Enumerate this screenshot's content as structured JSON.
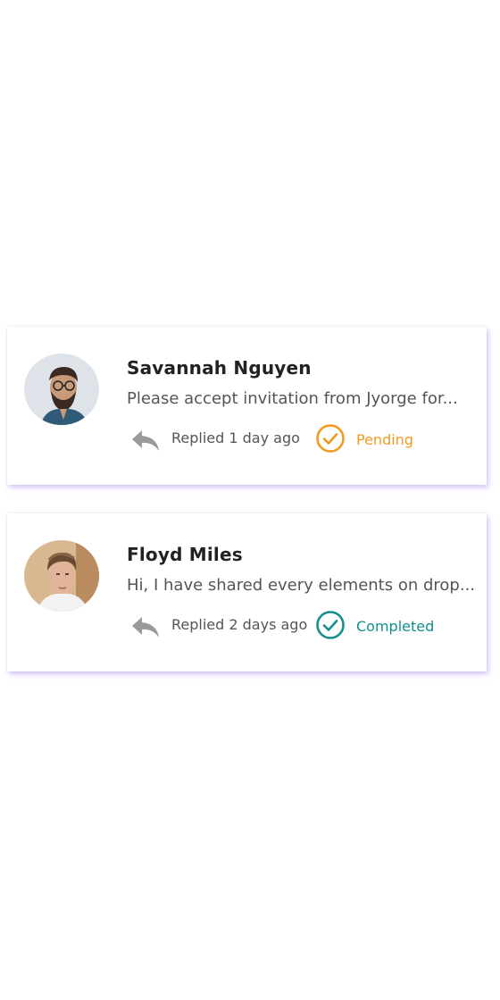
{
  "colors": {
    "pending": "#F29A1F",
    "completed": "#12908E",
    "icon_gray": "#9A9A9A",
    "card_shadow": "#A078F0"
  },
  "messages": [
    {
      "name": "Savannah Nguyen",
      "preview": "Please accept invitation from Jyorge for...",
      "replied": "Replied 1 day ago",
      "status": "Pending",
      "status_icon": "check-circle-icon",
      "reply_icon": "reply-arrow-icon"
    },
    {
      "name": "Floyd Miles",
      "preview": "Hi, I have shared every elements on drop...",
      "replied": "Replied 2 days ago",
      "status": "Completed",
      "status_icon": "check-circle-icon",
      "reply_icon": "reply-arrow-icon"
    }
  ]
}
